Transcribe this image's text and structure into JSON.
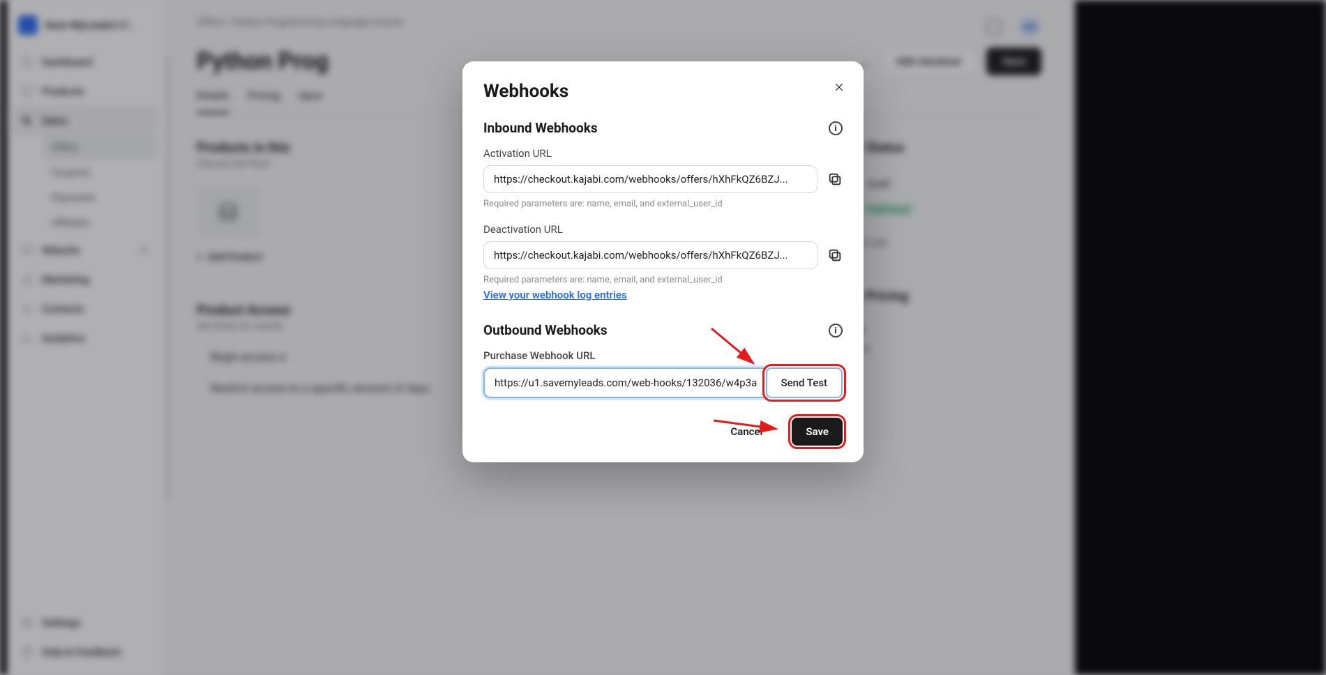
{
  "brand": {
    "name": "Save MyLeads's F..."
  },
  "sidebar": {
    "items": [
      {
        "label": "Dashboard"
      },
      {
        "label": "Products"
      },
      {
        "label": "Sales"
      },
      {
        "label": "Website"
      },
      {
        "label": "Marketing"
      },
      {
        "label": "Contacts"
      },
      {
        "label": "Analytics"
      }
    ],
    "sales_sub": [
      {
        "label": "Offers"
      },
      {
        "label": "Coupons"
      },
      {
        "label": "Payments"
      },
      {
        "label": "Affiliates"
      }
    ],
    "footer": [
      {
        "label": "Settings"
      },
      {
        "label": "Help & Feedback"
      }
    ]
  },
  "breadcrumb": {
    "a": "Offers",
    "sep": "/",
    "b": "Python Programming Language Course"
  },
  "page": {
    "title": "Python Prog",
    "actions": {
      "more": "…",
      "edit": "Edit checkout",
      "save": "Save"
    },
    "tabs": [
      "Details",
      "Pricing",
      "Upse"
    ]
  },
  "panel": {
    "products": {
      "h": "Products in this",
      "sub": "Choose the Prod",
      "add": "Add Product"
    },
    "access": {
      "h": "Product Access",
      "sub": "Set limits for memb",
      "line1": "Begin access a",
      "line2": "Restrict access to a specific amount of days"
    }
  },
  "side": {
    "status_h": "Offer Status",
    "draft": "Draft",
    "published": "Published",
    "getlink": "Get Link",
    "pricing_h": "Offer Pricing",
    "price": "Free",
    "price_sub": "Unlisted"
  },
  "header": {
    "avatar": "SM"
  },
  "modal": {
    "title": "Webhooks",
    "inbound_h": "Inbound Webhooks",
    "activation_label": "Activation URL",
    "activation_value": "https://checkout.kajabi.com/webhooks/offers/hXhFkQZ6BZJ...",
    "params_help": "Required parameters are: name, email, and external_user_id",
    "deactivation_label": "Deactivation URL",
    "deactivation_value": "https://checkout.kajabi.com/webhooks/offers/hXhFkQZ6BZJ...",
    "log_link": "View your webhook log entries",
    "outbound_h": "Outbound Webhooks",
    "purchase_label": "Purchase Webhook URL",
    "purchase_value": "https://u1.savemyleads.com/web-hooks/132036/w4p3a",
    "send_test": "Send Test",
    "cancel": "Cancel",
    "save": "Save"
  },
  "highlight_color": "#e41b1b"
}
